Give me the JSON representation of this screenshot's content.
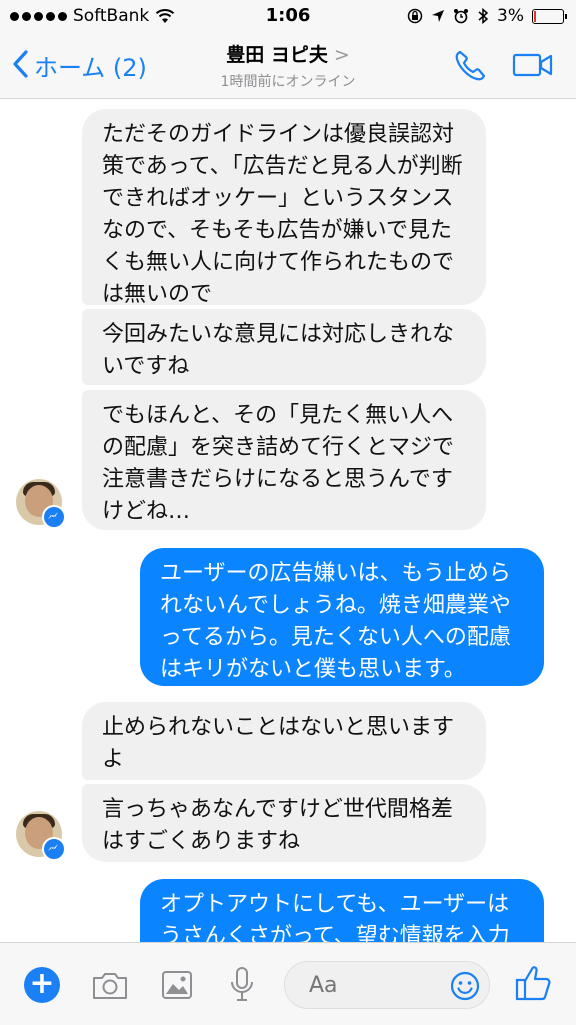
{
  "status_bar": {
    "carrier": "SoftBank",
    "time": "1:06",
    "battery": "3%"
  },
  "nav": {
    "back_label": "ホーム (2)",
    "contact_name": "豊田 ヨピ夫",
    "contact_arrow": ">",
    "presence": "1時間前にオンライン"
  },
  "messages": [
    {
      "side": "in",
      "text": "ただそのガイドラインは優良誤認対策であって、「広告だと見る人が判断できればオッケー」というスタンスなので、そもそも広告が嫌いで見たくも無い人に向けて作られたものでは無いので"
    },
    {
      "side": "in",
      "text": "今回みたいな意見には対応しきれないですね"
    },
    {
      "side": "in",
      "text": "でもほんと、その「見たく無い人への配慮」を突き詰めて行くとマジで注意書きだらけになると思うんですけどね…"
    },
    {
      "side": "out",
      "text": "ユーザーの広告嫌いは、もう止められないんでしょうね。焼き畑農業やってるから。見たくない人への配慮はキリがないと僕も思います。"
    },
    {
      "side": "in",
      "text": "止められないことはないと思いますよ"
    },
    {
      "side": "in",
      "text": "言っちゃあなんですけど世代間格差はすごくありますね"
    },
    {
      "side": "out",
      "text": "オプトアウトにしても、ユーザーはうさんくさがって、望む情報を入力"
    }
  ],
  "composer": {
    "placeholder": "Aa",
    "icons": [
      "plus-icon",
      "camera-icon",
      "image-icon",
      "microphone-icon",
      "emoji-icon",
      "thumbs-up-icon"
    ]
  },
  "colors": {
    "accent": "#1a80f4",
    "outgoing_bubble": "#0a84ff",
    "incoming_bubble": "#f1f0f0"
  }
}
